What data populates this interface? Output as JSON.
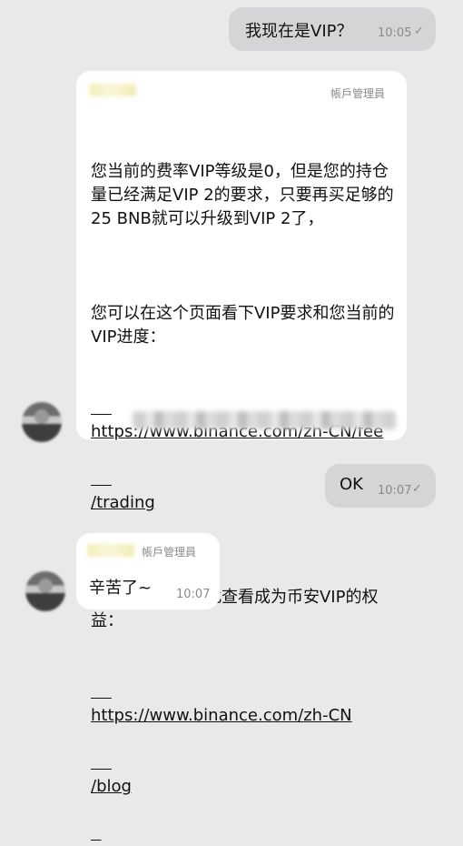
{
  "messages": {
    "m1": {
      "text": "我现在是VIP？",
      "time": "10:05",
      "status_icon": "✓"
    },
    "m2": {
      "sender_label": "帳戶管理員",
      "body_p1": "您当前的费率VIP等级是0，但是您的持仓量已经满足VIP 2的要求，只要再买足够的25 BNB就可以升级到VIP 2了，",
      "body_p2": "您可以在这个页面看下VIP要求和您当前的VIP进度：",
      "link1_line1": "https://www.binance.com/zh-CN/fee",
      "link1_line2": "/trading",
      "body_p3": "同时，您可以在此查看成为币安VIP的权益：",
      "link2_line1": "https://www.binance.com/zh-CN",
      "link2_line2": "/blog"
    },
    "m3": {
      "text": "OK",
      "time": "10:07",
      "status_icon": "✓"
    },
    "m4": {
      "sender_label": "帳戶管理員",
      "text": "辛苦了~",
      "time": "10:07"
    }
  }
}
